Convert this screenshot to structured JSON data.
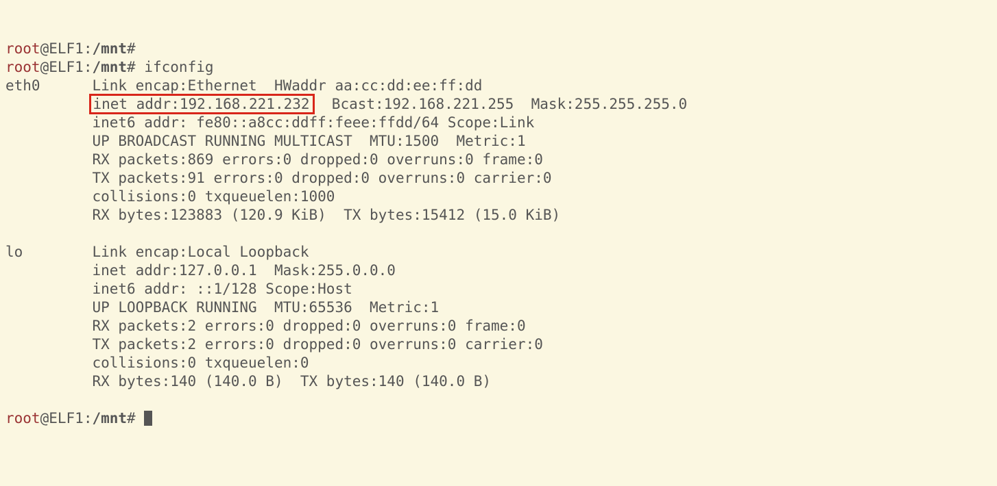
{
  "prompt": {
    "user": "root",
    "at": "@",
    "host": "ELF1",
    "colon": ":",
    "path": "/mnt",
    "hash": "#"
  },
  "cmd_ifconfig": "ifconfig",
  "eth0": {
    "name": "eth0",
    "link": "Link encap:Ethernet  HWaddr aa:cc:dd:ee:ff:dd",
    "inet_highlight": "inet addr:192.168.221.232",
    "inet_rest": "  Bcast:192.168.221.255  Mask:255.255.255.0",
    "inet6": "inet6 addr: fe80::a8cc:ddff:feee:ffdd/64 Scope:Link",
    "flags": "UP BROADCAST RUNNING MULTICAST  MTU:1500  Metric:1",
    "rx_pkts": "RX packets:869 errors:0 dropped:0 overruns:0 frame:0",
    "tx_pkts": "TX packets:91 errors:0 dropped:0 overruns:0 carrier:0",
    "coll": "collisions:0 txqueuelen:1000",
    "bytes": "RX bytes:123883 (120.9 KiB)  TX bytes:15412 (15.0 KiB)"
  },
  "lo": {
    "name": "lo",
    "link": "Link encap:Local Loopback",
    "inet": "inet addr:127.0.0.1  Mask:255.0.0.0",
    "inet6": "inet6 addr: ::1/128 Scope:Host",
    "flags": "UP LOOPBACK RUNNING  MTU:65536  Metric:1",
    "rx_pkts": "RX packets:2 errors:0 dropped:0 overruns:0 frame:0",
    "tx_pkts": "TX packets:2 errors:0 dropped:0 overruns:0 carrier:0",
    "coll": "collisions:0 txqueuelen:0",
    "bytes": "RX bytes:140 (140.0 B)  TX bytes:140 (140.0 B)"
  }
}
